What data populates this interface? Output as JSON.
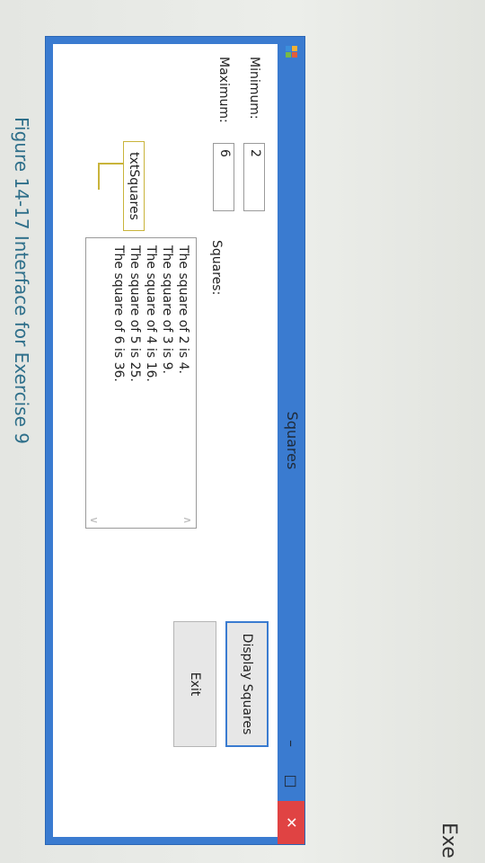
{
  "window": {
    "title": "Squares",
    "minimize_glyph": "–",
    "maximize_glyph": "□",
    "close_glyph": "✕"
  },
  "form": {
    "minimum_label": "Minimum:",
    "minimum_value": "2",
    "maximum_label": "Maximum:",
    "maximum_value": "6",
    "squares_label": "Squares:",
    "squares_lines": [
      "The square of 2 is 4.",
      "The square of 3 is 9.",
      "The square of 4 is 16.",
      "The square of 5 is 25.",
      "The square of 6 is 36."
    ],
    "display_button": "Display Squares",
    "exit_button": "Exit",
    "callout_label": "txtSquares"
  },
  "page": {
    "caption": "Figure 14-17   Interface for Exercise 9",
    "side_word": "Exe"
  },
  "colors": {
    "title_bar": "#3a7bd0",
    "close_button": "#e04343",
    "callout_border": "#c9b43b"
  },
  "icons": [
    "app-icon",
    "minimize-icon",
    "maximize-icon",
    "close-icon"
  ]
}
